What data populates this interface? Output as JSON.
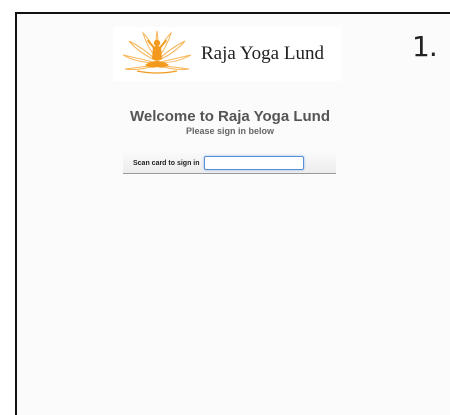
{
  "step": {
    "number": "1."
  },
  "logo": {
    "icon": "yoga-lotus-icon",
    "text": "Raja Yoga Lund",
    "colors": {
      "figure": "#f39a1e",
      "petals": "#f7b455"
    }
  },
  "welcome": {
    "title": "Welcome to Raja Yoga Lund",
    "subtitle": "Please sign in below"
  },
  "signin": {
    "label": "Scan card to sign in",
    "input_value": ""
  },
  "colors": {
    "input_focus": "#5b8fd6",
    "text_gray": "#555555"
  }
}
